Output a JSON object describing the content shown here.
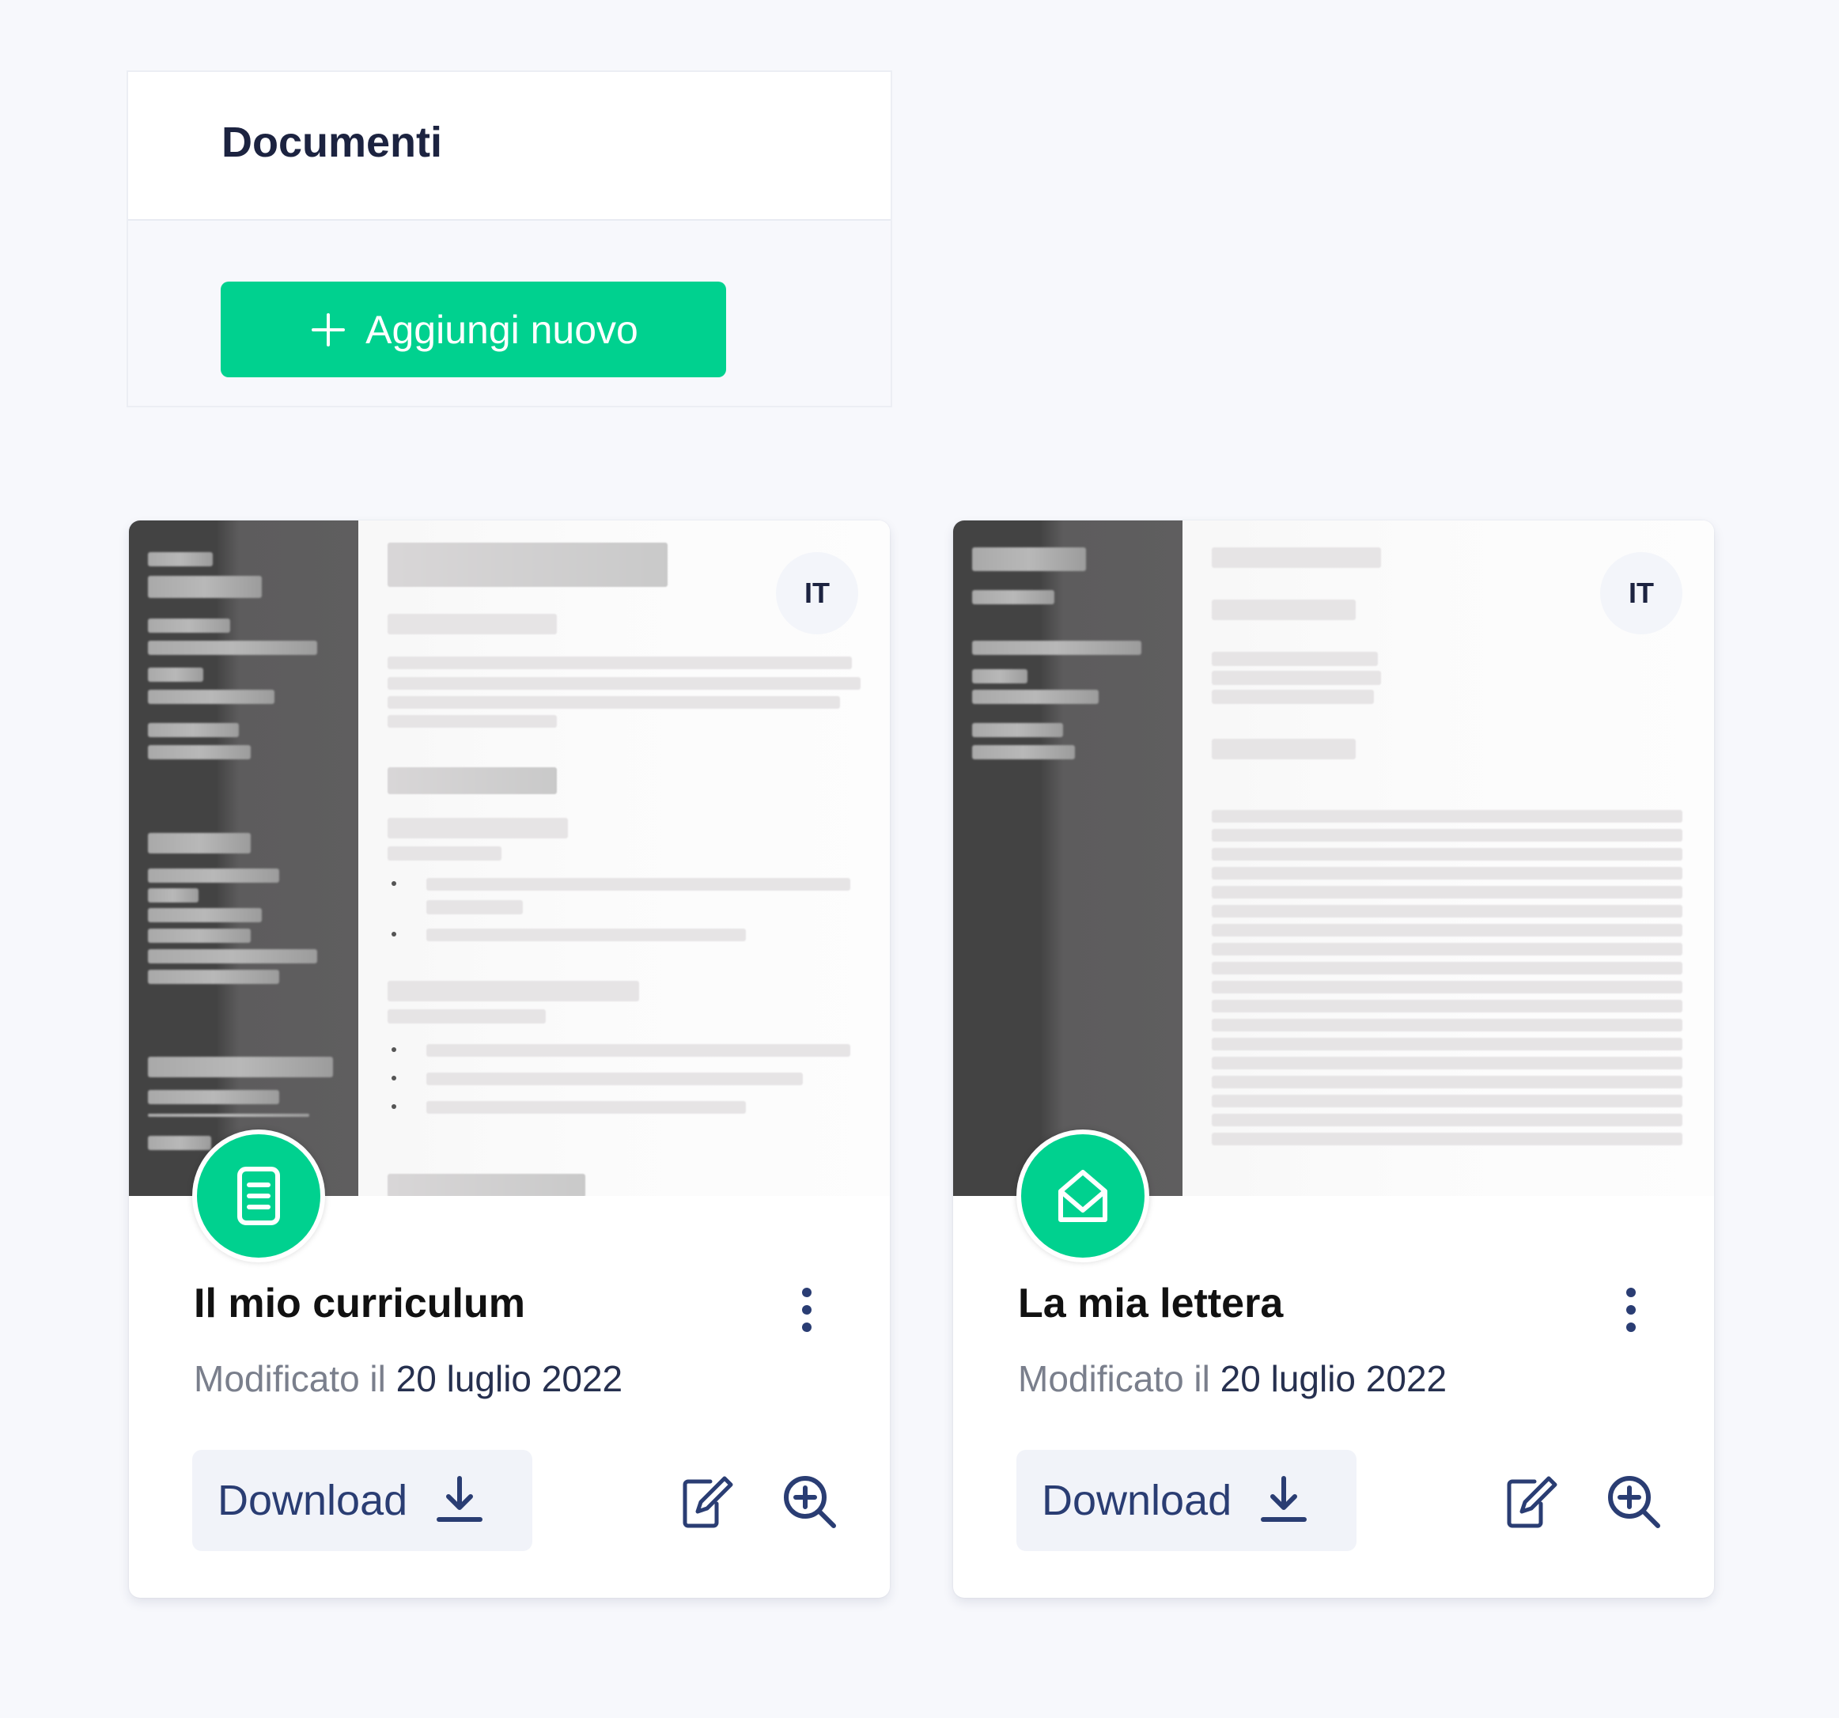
{
  "header": {
    "title": "Documenti",
    "add_button_label": "Aggiungi nuovo"
  },
  "colors": {
    "accent": "#00d18f",
    "text_dark": "#1c2340",
    "icon_blue": "#2a3d73",
    "background": "#f7f8fc"
  },
  "documents": [
    {
      "title": "Il mio curriculum",
      "type_icon": "document-icon",
      "language": "IT",
      "modified_prefix": "Modificato il",
      "modified_date": "20 luglio 2022",
      "download_label": "Download"
    },
    {
      "title": "La mia lettera",
      "type_icon": "envelope-open-icon",
      "language": "IT",
      "modified_prefix": "Modificato il",
      "modified_date": "20 luglio 2022",
      "download_label": "Download"
    }
  ]
}
